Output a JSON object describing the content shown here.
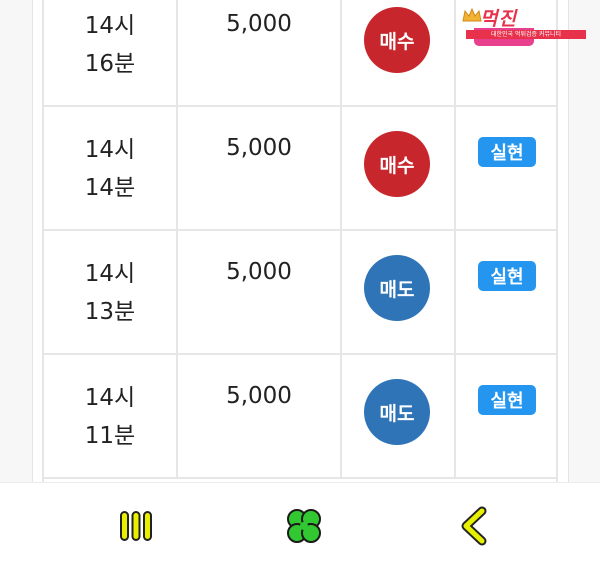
{
  "rows": [
    {
      "hour": "14시",
      "minute": "16분",
      "amount": "5,000",
      "action": "매수",
      "action_type": "buy",
      "status": ""
    },
    {
      "hour": "14시",
      "minute": "14분",
      "amount": "5,000",
      "action": "매수",
      "action_type": "buy",
      "status": "실현"
    },
    {
      "hour": "14시",
      "minute": "13분",
      "amount": "5,000",
      "action": "매도",
      "action_type": "sell",
      "status": "실현"
    },
    {
      "hour": "14시",
      "minute": "11분",
      "amount": "5,000",
      "action": "매도",
      "action_type": "sell",
      "status": "실현"
    }
  ],
  "watermark": {
    "title": "먹진",
    "subtitle": "대한민국 먹튀검증 커뮤니티"
  },
  "colors": {
    "buy": "#c8262d",
    "sell": "#2f74b6",
    "status_badge": "#2496ef",
    "nav_icon": "#e6f000"
  },
  "bottom_nav": {
    "items": [
      "menu-icon",
      "clover-icon",
      "back-icon"
    ]
  }
}
